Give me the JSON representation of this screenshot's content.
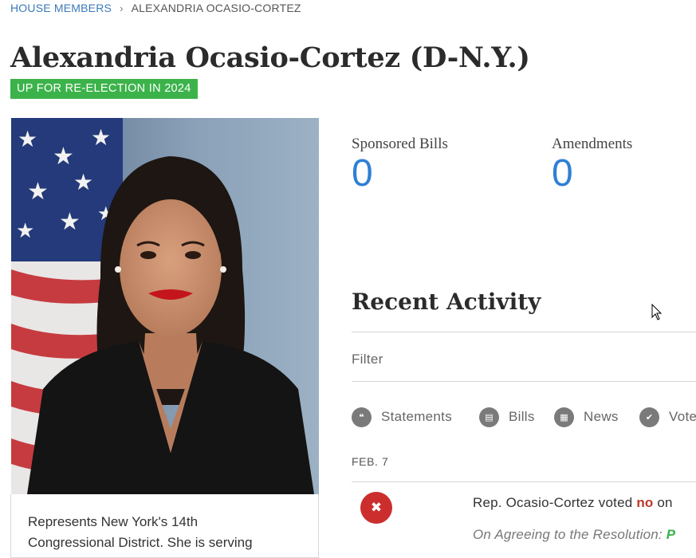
{
  "breadcrumb": {
    "parent": "HOUSE MEMBERS",
    "separator": "›",
    "current": "ALEXANDRIA OCASIO-CORTEZ"
  },
  "member": {
    "name": "Alexandria Ocasio-Cortez (D-N.Y.)",
    "badge": "UP FOR RE-ELECTION IN 2024",
    "bio_line1": "Represents New York's 14th",
    "bio_line2": "Congressional District. She is serving"
  },
  "stats": [
    {
      "label": "Sponsored Bills",
      "value": "0"
    },
    {
      "label": "Amendments",
      "value": "0"
    }
  ],
  "recent_activity": {
    "title": "Recent Activity",
    "filter_label": "Filter",
    "filters": [
      {
        "label": "Statements",
        "icon": "quote-icon",
        "glyph": "❝"
      },
      {
        "label": "Bills",
        "icon": "document-icon",
        "glyph": "▤"
      },
      {
        "label": "News",
        "icon": "newspaper-icon",
        "glyph": "▦"
      },
      {
        "label": "Votes",
        "icon": "checkmark-icon",
        "glyph": "✔"
      }
    ],
    "items": [
      {
        "date": "FEB. 7",
        "icon": "x-icon",
        "icon_glyph": "✖",
        "text_prefix": "Rep. Ocasio-Cortez voted ",
        "vote": "no",
        "text_suffix": " on",
        "question": "On Agreeing to the Resolution: ",
        "result": "P"
      }
    ]
  },
  "colors": {
    "badge_green": "#3cb34a",
    "stat_blue": "#2e7fd6",
    "link_blue": "#3a7ab8",
    "vote_red": "#cc2e2e"
  }
}
